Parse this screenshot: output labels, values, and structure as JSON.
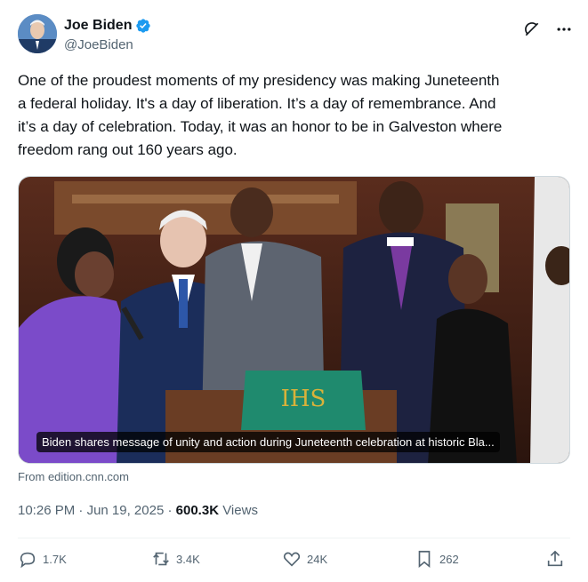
{
  "author": {
    "name": "Joe Biden",
    "handle": "@JoeBiden",
    "verified_icon": "verified-badge-icon"
  },
  "header_actions": {
    "grok_icon": "grok-icon",
    "more_icon": "more-icon"
  },
  "tweet": {
    "text": "One of the proudest moments of my presidency was making Juneteenth\na federal holiday. It's a day of liberation. It’s a day of remembrance. And\nit’s a day of celebration. Today, it was an honor to be in Galveston where\nfreedom rang out 160 years ago."
  },
  "media": {
    "caption": "Biden shares message of unity and action during Juneteenth celebration at historic Bla...",
    "source": "From edition.cnn.com"
  },
  "meta": {
    "time": "10:26 PM",
    "separator": " · ",
    "date": "Jun 19, 2025",
    "views_count": "600.3K",
    "views_label": " Views"
  },
  "actions": {
    "replies": "1.7K",
    "reposts": "3.4K",
    "likes": "24K",
    "bookmarks": "262"
  },
  "colors": {
    "verified": "#1d9bf0",
    "secondary_text": "#536471",
    "primary_text": "#0f1419"
  }
}
